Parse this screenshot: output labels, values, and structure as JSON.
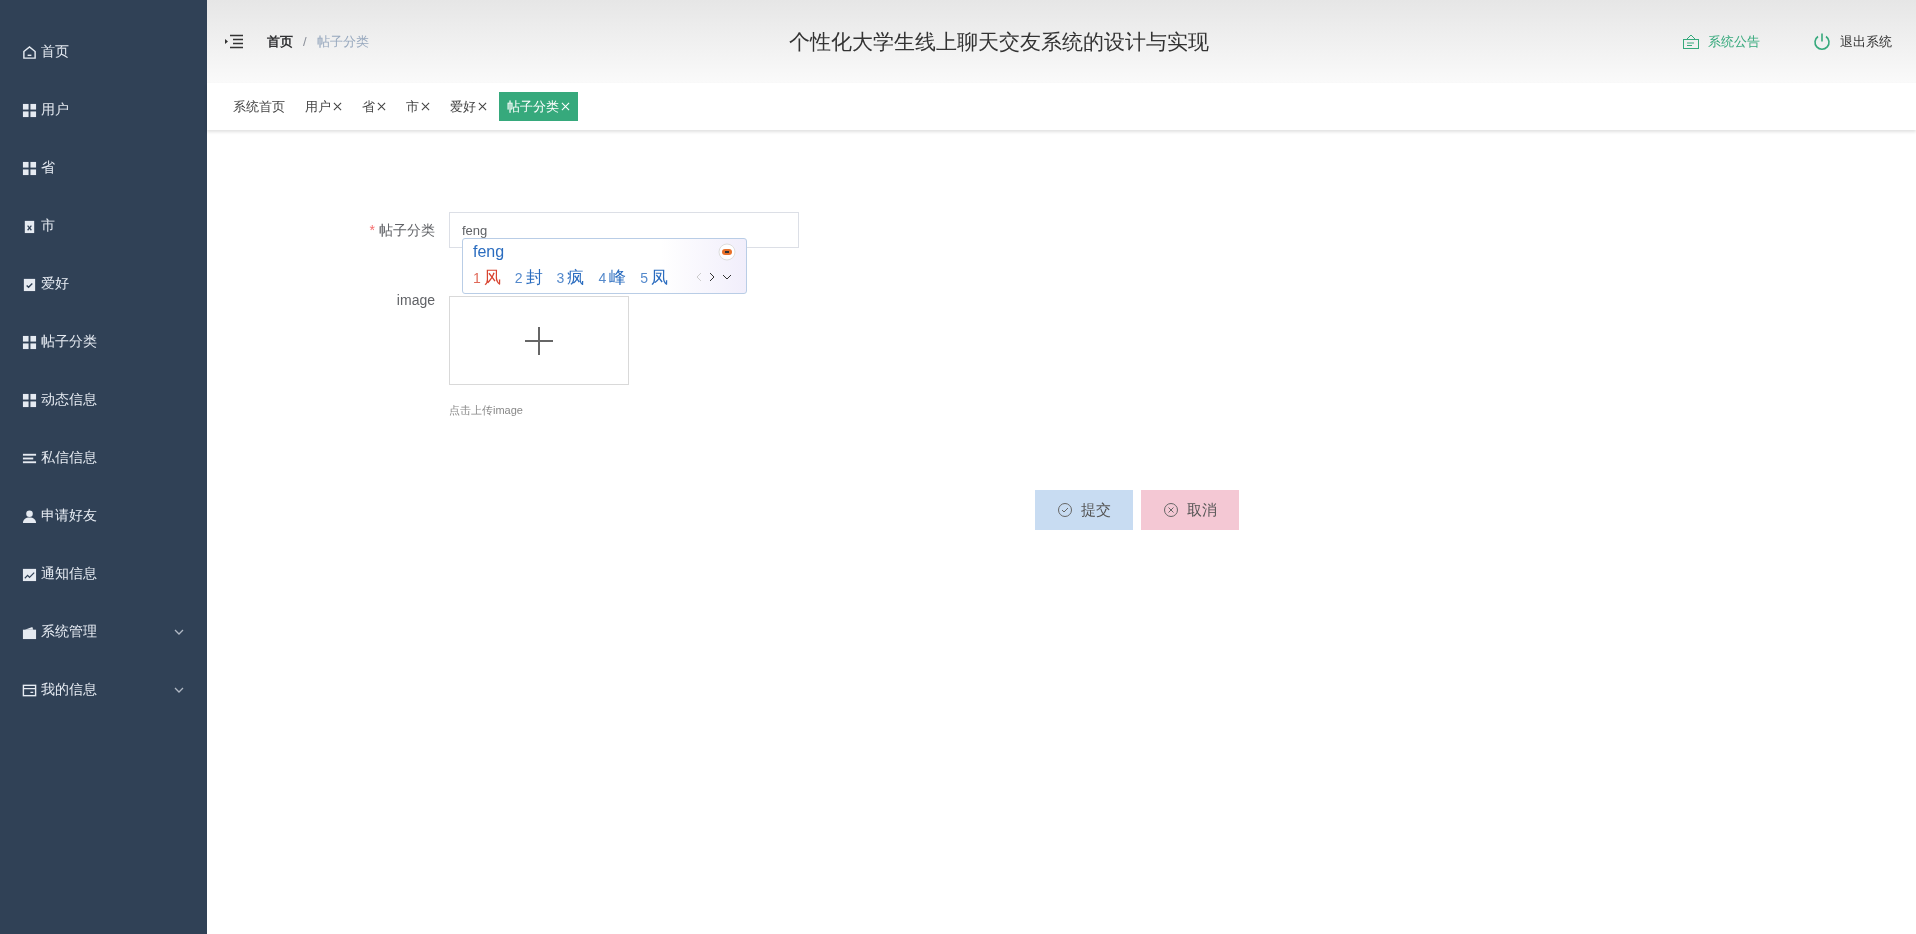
{
  "sidebar": {
    "items": [
      {
        "label": "首页",
        "kind": "link"
      },
      {
        "label": "用户",
        "kind": "link"
      },
      {
        "label": "省",
        "kind": "link"
      },
      {
        "label": "市",
        "kind": "link"
      },
      {
        "label": "爱好",
        "kind": "link"
      },
      {
        "label": "帖子分类",
        "kind": "link"
      },
      {
        "label": "动态信息",
        "kind": "link"
      },
      {
        "label": "私信信息",
        "kind": "link"
      },
      {
        "label": "申请好友",
        "kind": "link"
      },
      {
        "label": "通知信息",
        "kind": "link"
      },
      {
        "label": "系统管理",
        "kind": "menu",
        "expanded": false
      },
      {
        "label": "我的信息",
        "kind": "menu",
        "expanded": false
      }
    ]
  },
  "header": {
    "breadcrumb": [
      "首页",
      "帖子分类"
    ],
    "breadcrumb_separator": "/",
    "title": "个性化大学生线上聊天交友系统的设计与实现",
    "notice": "系统公告",
    "logout": "退出系统"
  },
  "tabs": [
    {
      "label": "系统首页",
      "selected": false,
      "closable": false
    },
    {
      "label": "用户",
      "selected": false,
      "closable": true
    },
    {
      "label": "省",
      "selected": false,
      "closable": true
    },
    {
      "label": "市",
      "selected": false,
      "closable": true
    },
    {
      "label": "爱好",
      "selected": false,
      "closable": true
    },
    {
      "label": "帖子分类",
      "selected": true,
      "closable": true
    }
  ],
  "form": {
    "category": {
      "label": "帖子分类",
      "required_mark": "*",
      "value": "feng"
    },
    "image": {
      "label": "image",
      "hint": "点击上传image"
    },
    "buttons": [
      {
        "label": "提交",
        "kind": "submit"
      },
      {
        "label": "取消",
        "kind": "cancel"
      }
    ]
  },
  "ime_popup": {
    "composition": "feng",
    "candidates": [
      {
        "number": "1",
        "text": "风",
        "selected": true
      },
      {
        "number": "2",
        "text": "封",
        "selected": false
      },
      {
        "number": "3",
        "text": "疯",
        "selected": false
      },
      {
        "number": "4",
        "text": "峰",
        "selected": false
      },
      {
        "number": "5",
        "text": "凤",
        "selected": false
      }
    ]
  }
}
